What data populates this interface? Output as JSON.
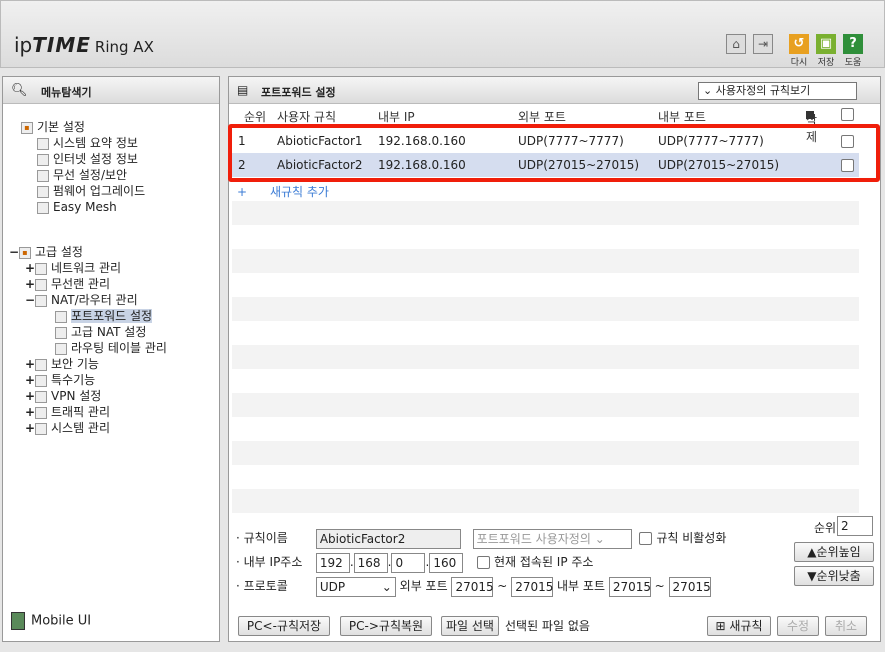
{
  "header": {
    "logo_ip": "ip",
    "logo_time": "TIME",
    "logo_model": "Ring AX",
    "actions": [
      {
        "label": "다시",
        "icon": "undo-icon",
        "color": "#e8a020"
      },
      {
        "label": "저장",
        "icon": "save-icon",
        "color": "#7ab030"
      },
      {
        "label": "도움",
        "icon": "help-icon",
        "color": "#2f8f3a"
      }
    ]
  },
  "sidebar": {
    "title": "메뉴탐색기",
    "basic_group": "기본 설정",
    "basic_items": [
      "시스템 요약 정보",
      "인터넷 설정 정보",
      "무선 설정/보안",
      "펌웨어 업그레이드",
      "Easy Mesh"
    ],
    "advanced_group": "고급 설정",
    "advanced_items": [
      "네트워크 관리",
      "무선랜 관리",
      "NAT/라우터 관리"
    ],
    "nat_sub": [
      "포트포워드 설정",
      "고급 NAT 설정",
      "라우팅 테이블 관리"
    ],
    "advanced_items2": [
      "보안 기능",
      "특수기능",
      "VPN 설정",
      "트래픽 관리",
      "시스템 관리"
    ],
    "mobile": "Mobile UI"
  },
  "main": {
    "title": "포트포워드 설정",
    "view_select": "사용자정의 규칙보기",
    "columns": [
      "순위",
      "사용자 규칙",
      "내부 IP",
      "외부 포트",
      "내부 포트",
      "삭제"
    ],
    "rows": [
      {
        "rank": "1",
        "name": "AbioticFactor1",
        "ip": "192.168.0.160",
        "ext": "UDP(7777~7777)",
        "int": "UDP(7777~7777)"
      },
      {
        "rank": "2",
        "name": "AbioticFactor2",
        "ip": "192.168.0.160",
        "ext": "UDP(27015~27015)",
        "int": "UDP(27015~27015)"
      }
    ],
    "add_rule": "새규칙 추가"
  },
  "form": {
    "rule_name_label": "· 규칙이름",
    "rule_name": "AbioticFactor2",
    "preset": "포트포워드 사용자정의",
    "disable_label": "규칙 비활성화",
    "ip_label": "· 내부 IP주소",
    "ip1": "192",
    "ip2": "168",
    "ip3": "0",
    "ip4": "160",
    "current_ip_label": "현재 접속된 IP 주소",
    "proto_label": "· 프로토콜",
    "proto": "UDP",
    "ext_port_label": "외부 포트",
    "ext_from": "27015",
    "ext_to": "27015",
    "int_port_label": "내부 포트",
    "int_from": "27015",
    "int_to": "27015",
    "tilde": "~",
    "rank_label": "순위",
    "rank": "2",
    "up": "순위높임",
    "down": "순위낮춤"
  },
  "buttons": {
    "save_pc": "PC<-규칙저장",
    "restore_pc": "PC->규칙복원",
    "file": "파일 선택",
    "no_file": "선택된 파일 없음",
    "new_rule": "새규칙",
    "edit": "수정",
    "cancel": "취소"
  }
}
